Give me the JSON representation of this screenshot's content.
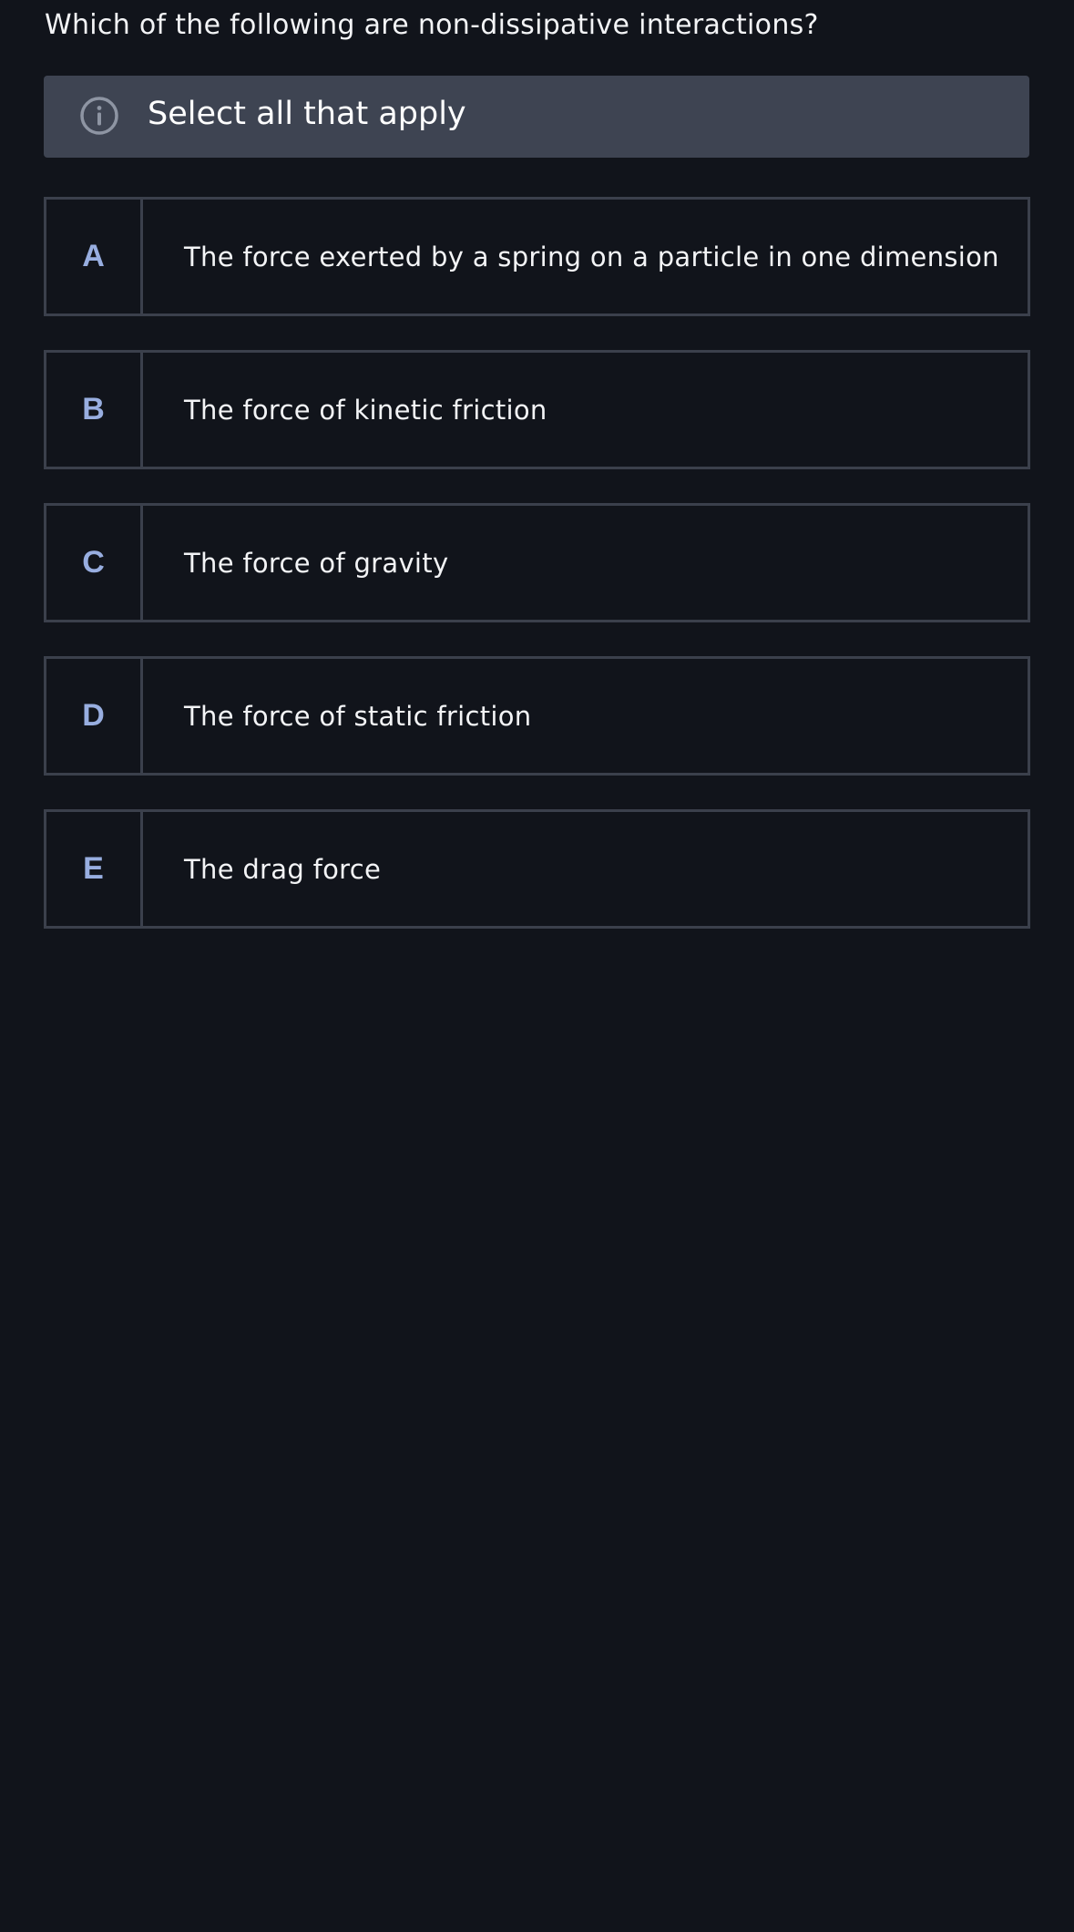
{
  "question": {
    "text": "Which of the following are non-dissipative interactions?"
  },
  "instruction": {
    "icon": "info-icon",
    "text": "Select all that apply"
  },
  "options": [
    {
      "letter": "A",
      "text": "The force exerted by a spring on a particle in one dimension"
    },
    {
      "letter": "B",
      "text": "The force of kinetic friction"
    },
    {
      "letter": "C",
      "text": "The force of gravity"
    },
    {
      "letter": "D",
      "text": "The force of static friction"
    },
    {
      "letter": "E",
      "text": "The drag force"
    }
  ],
  "colors": {
    "background": "#11141b",
    "instruction_bg": "#3e4452",
    "border": "#3b404c",
    "letter": "#98aee0",
    "text": "#f3f4f6"
  }
}
